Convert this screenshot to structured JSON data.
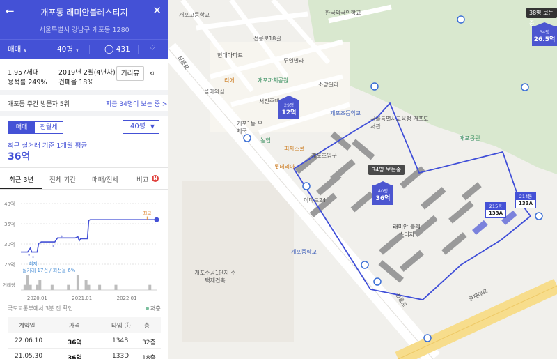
{
  "header": {
    "title": "개포동 래미안블레스티지",
    "address": "서울특별시 강남구 개포동 1280",
    "trade_type": "매매",
    "size": "40평",
    "comment_count": "431"
  },
  "summary": {
    "households": "1,957세대",
    "built": "2019년 2월(4년차)",
    "floor_area_ratio": "용적률 249%",
    "building_coverage": "건폐율 18%",
    "review_button": "거리뷰"
  },
  "visitors": {
    "text": "개포동 주간 방문자 5위",
    "link": "지금 34명이 보는 중 >"
  },
  "price": {
    "tab_sale": "매매",
    "tab_jeonse": "전월세",
    "size_select": "40평",
    "avg_desc": "최근 실거래 기준 1개월 평균",
    "avg_price": "36억"
  },
  "period_tabs": [
    "최근 3년",
    "전체 기간",
    "매매/전세",
    "비교"
  ],
  "compare_badge": "N",
  "chart_data": {
    "type": "line",
    "y_ticks": [
      "40억",
      "35억",
      "30억",
      "25억"
    ],
    "ylim": [
      25,
      40
    ],
    "x_ticks": [
      "2020.01",
      "2021.01",
      "2022.01"
    ],
    "volume_label": "거래량",
    "max_label": "최고",
    "min_label": "최저",
    "footnote": "실거래 17건 / 회전율 6%",
    "series": [
      {
        "x": [
          0.0,
          0.05,
          0.07,
          0.08,
          0.12,
          0.13,
          0.15,
          0.25,
          0.27,
          0.28,
          0.4,
          0.42,
          0.43,
          0.44,
          0.49,
          0.5,
          0.51,
          1.0
        ],
        "values": [
          28,
          28,
          29,
          28,
          28,
          30,
          30.5,
          30.5,
          31.5,
          31.5,
          31.5,
          31.8,
          30.8,
          31.3,
          31.3,
          35.8,
          36,
          36
        ]
      }
    ],
    "volume": [
      {
        "x": 0.03,
        "v": 1
      },
      {
        "x": 0.05,
        "v": 3
      },
      {
        "x": 0.07,
        "v": 1
      },
      {
        "x": 0.12,
        "v": 1
      },
      {
        "x": 0.14,
        "v": 2
      },
      {
        "x": 0.23,
        "v": 1
      },
      {
        "x": 0.35,
        "v": 1
      },
      {
        "x": 0.42,
        "v": 3
      },
      {
        "x": 0.48,
        "v": 2
      },
      {
        "x": 0.5,
        "v": 1
      },
      {
        "x": 0.58,
        "v": 1
      },
      {
        "x": 0.7,
        "v": 1
      },
      {
        "x": 0.95,
        "v": 1
      }
    ],
    "line_color": "#4451d6"
  },
  "source_note": "국토교통부에서 3분 전 확인",
  "legend_label": "저층",
  "table": {
    "headers": [
      "계약일",
      "가격",
      "타입",
      "층"
    ],
    "rows": [
      [
        "22.06.10",
        "36억",
        "134B",
        "32층"
      ],
      [
        "21.05.30",
        "36억",
        "133D",
        "18층"
      ]
    ]
  },
  "map": {
    "labels": {
      "school_top": "개포고등학교",
      "hufs": "한국외국인학교",
      "hyundai": "현대아파트",
      "duil": "두일빌라",
      "seonneung18": "선릉로18길",
      "rie": "리에",
      "gaepo_park": "개포까치공원",
      "somang": "소망빌라",
      "eulma": "을마의집",
      "seojin": "서진주택",
      "gaepo_school": "개포초등학교",
      "office": "서울특별시교육청 개포도서관",
      "gaepo1": "개포1동 우체국",
      "nonghyup": "농협",
      "pizza": "피자스쿨",
      "park": "개포공원",
      "lotteria": "롯데리아",
      "entrance": "개포초입구",
      "imart": "이마트24",
      "raemian": "래미안 블레스티지",
      "middle": "개포중학교",
      "town": "개포주공1단지 주택재건축",
      "seonneung_road": "선릉로",
      "yangjae": "양재대로",
      "seonneung_road2": "선릉로",
      "dong215": "215동",
      "dong214": "214동",
      "type215": "133A",
      "type214": "133A"
    },
    "visitor_tag": "34명 보는중",
    "tag38": "38명 보는중",
    "markers": [
      {
        "size": "40평",
        "price": "36억"
      },
      {
        "size": "29평",
        "price": "12억"
      },
      {
        "size": "34평",
        "price": "26.5억"
      }
    ]
  }
}
